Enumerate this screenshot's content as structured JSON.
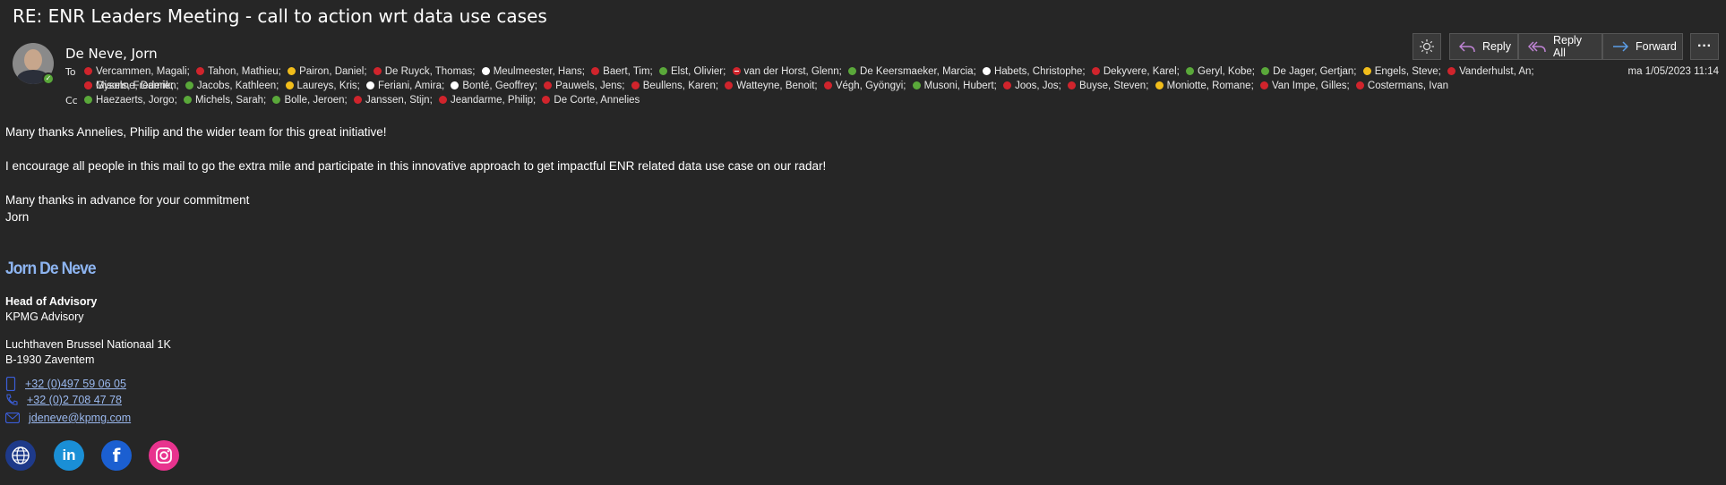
{
  "email": {
    "subject": "RE: ENR Leaders Meeting - call to action wrt data use cases",
    "sender": "De Neve, Jorn",
    "to_label": "To",
    "cc_label": "Cc",
    "date": "ma 1/05/2023 11:14",
    "to_line1": [
      {
        "name": "Vercammen, Magali;",
        "status": "busy"
      },
      {
        "name": "Tahon, Mathieu;",
        "status": "busy"
      },
      {
        "name": "Pairon, Daniel;",
        "status": "away"
      },
      {
        "name": "De Ruyck, Thomas;",
        "status": "busy"
      },
      {
        "name": "Meulmeester, Hans;",
        "status": "offline"
      },
      {
        "name": "Baert, Tim;",
        "status": "busy"
      },
      {
        "name": "Elst, Olivier;",
        "status": "available"
      },
      {
        "name": "van der Horst, Glenn;",
        "status": "dnd"
      },
      {
        "name": "De Keersmaeker, Marcia;",
        "status": "available"
      },
      {
        "name": "Habets, Christophe;",
        "status": "offline"
      },
      {
        "name": "Dekyvere, Karel;",
        "status": "busy"
      },
      {
        "name": "Geryl, Kobe;",
        "status": "available"
      },
      {
        "name": "De Jager, Gertjan;",
        "status": "available"
      },
      {
        "name": "Engels, Steve;",
        "status": "away"
      },
      {
        "name": "Vanderhulst, An;",
        "status": "busy"
      },
      {
        "name": "Gysels, Frederik;",
        "status": "busy"
      }
    ],
    "to_line2": [
      {
        "name": "Misonne, Damien;",
        "status": "busy"
      },
      {
        "name": "Jacobs, Kathleen;",
        "status": "available"
      },
      {
        "name": "Laureys, Kris;",
        "status": "away"
      },
      {
        "name": "Feriani, Amira;",
        "status": "offline"
      },
      {
        "name": "Bonté, Geoffrey;",
        "status": "offline"
      },
      {
        "name": "Pauwels, Jens;",
        "status": "busy"
      },
      {
        "name": "Beullens, Karen;",
        "status": "busy"
      },
      {
        "name": "Watteyne, Benoit;",
        "status": "busy"
      },
      {
        "name": "Végh, Gyöngyi;",
        "status": "busy"
      },
      {
        "name": "Musoni, Hubert;",
        "status": "available"
      },
      {
        "name": "Joos, Jos;",
        "status": "busy"
      },
      {
        "name": "Buyse, Steven;",
        "status": "busy"
      },
      {
        "name": "Moniotte, Romane;",
        "status": "away"
      },
      {
        "name": "Van Impe, Gilles;",
        "status": "busy"
      },
      {
        "name": "Costermans, Ivan",
        "status": "busy"
      }
    ],
    "cc": [
      {
        "name": "Haezaerts, Jorgo;",
        "status": "available"
      },
      {
        "name": "Michels, Sarah;",
        "status": "available"
      },
      {
        "name": "Bolle, Jeroen;",
        "status": "available"
      },
      {
        "name": "Janssen, Stijn;",
        "status": "busy"
      },
      {
        "name": "Jeandarme, Philip;",
        "status": "busy"
      },
      {
        "name": "De Corte, Annelies",
        "status": "busy"
      }
    ]
  },
  "toolbar": {
    "reply": "Reply",
    "reply_all": "Reply All",
    "forward": "Forward",
    "more": "···"
  },
  "body": {
    "line1": "Many thanks Annelies, Philip and the wider team for this great initiative!",
    "line2": "I encourage all people in this mail to go the extra mile and participate in this innovative approach to get impactful ENR related data use case on our radar!",
    "line3": "Many thanks in advance for your commitment",
    "line4": "Jorn"
  },
  "signature": {
    "name": "Jorn De Neve",
    "title": "Head of Advisory",
    "company": "KPMG Advisory",
    "address1": "Luchthaven Brussel Nationaal 1K",
    "address2": "B-1930 Zaventem",
    "mobile": "+32 (0)497 59 06 05",
    "phone": "+32 (0)2 708 47 78",
    "email": "jdeneve@kpmg.com"
  },
  "status_colors": {
    "busy": "#d0242c",
    "available": "#5aa83a",
    "away": "#f1bd1b",
    "offline": "#ffffff"
  },
  "social_icons": [
    "globe-icon",
    "linkedin-icon",
    "facebook-icon",
    "instagram-icon"
  ]
}
